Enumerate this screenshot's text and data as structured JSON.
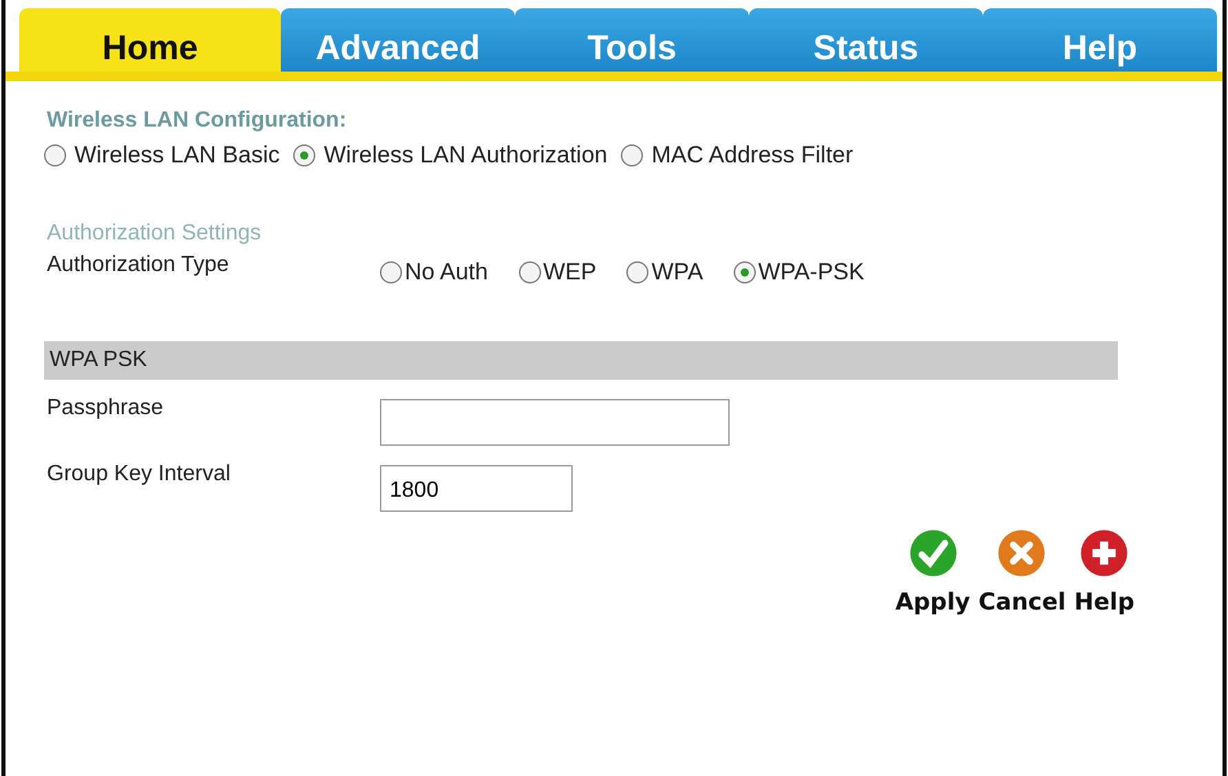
{
  "tabs": [
    {
      "label": "Home",
      "selected": true
    },
    {
      "label": "Advanced",
      "selected": false
    },
    {
      "label": "Tools",
      "selected": false
    },
    {
      "label": "Status",
      "selected": false
    },
    {
      "label": "Help",
      "selected": false
    }
  ],
  "config": {
    "title": "Wireless LAN Configuration:",
    "options": [
      {
        "label": "Wireless LAN Basic",
        "selected": false
      },
      {
        "label": "Wireless LAN Authorization",
        "selected": true
      },
      {
        "label": "MAC Address Filter",
        "selected": false
      }
    ]
  },
  "auth": {
    "title": "Authorization Settings",
    "label": "Authorization Type",
    "options": [
      {
        "label": "No Auth",
        "selected": false
      },
      {
        "label": "WEP",
        "selected": false
      },
      {
        "label": "WPA",
        "selected": false
      },
      {
        "label": "WPA-PSK",
        "selected": true
      }
    ]
  },
  "wpa_psk": {
    "title": "WPA PSK",
    "fields": [
      {
        "label": "Passphrase"
      },
      {
        "label": "Group Key Interval",
        "value": "1800"
      }
    ]
  },
  "buttons": [
    {
      "kind": "apply",
      "label": "Apply"
    },
    {
      "kind": "cancel",
      "label": "Cancel"
    },
    {
      "kind": "help",
      "label": "Help"
    }
  ]
}
